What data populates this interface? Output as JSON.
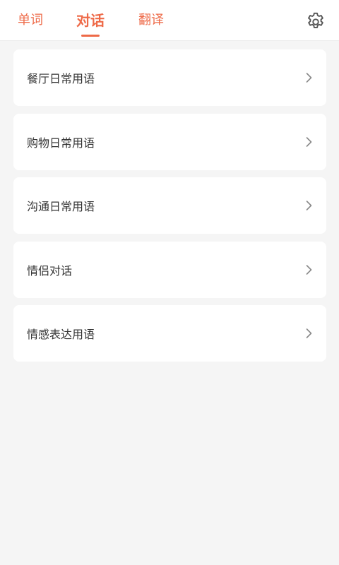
{
  "tabs": [
    {
      "label": "单词",
      "active": false
    },
    {
      "label": "对话",
      "active": true
    },
    {
      "label": "翻译",
      "active": false
    }
  ],
  "header": {
    "settings_icon": "gear-icon"
  },
  "items": [
    {
      "label": "餐厅日常用语",
      "icon": "chevron-right-icon"
    },
    {
      "label": "购物日常用语",
      "icon": "chevron-right-icon"
    },
    {
      "label": "沟通日常用语",
      "icon": "chevron-right-icon"
    },
    {
      "label": "情侣对话",
      "icon": "chevron-right-icon"
    },
    {
      "label": "情感表达用语",
      "icon": "chevron-right-icon"
    }
  ],
  "colors": {
    "accent": "#ee6a48",
    "background": "#f5f5f5",
    "card": "#ffffff",
    "text": "#333333",
    "chevron": "#888888"
  }
}
